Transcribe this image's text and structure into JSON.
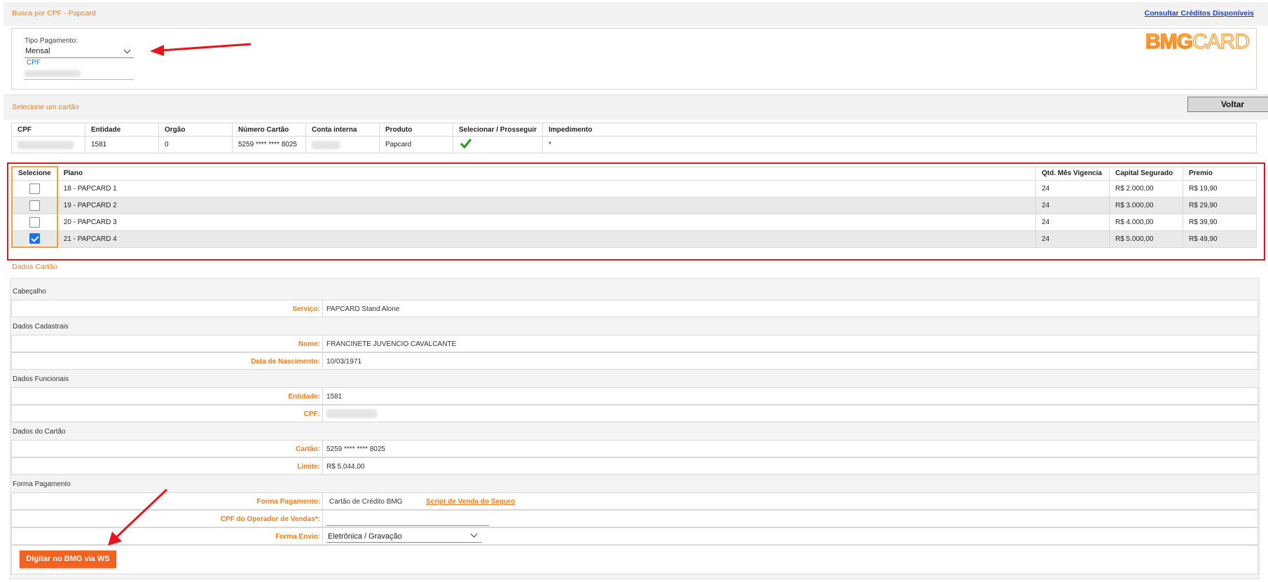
{
  "header": {
    "title": "Busca por CPF - Papcard",
    "link": "Consultar Créditos Disponíveis"
  },
  "filter": {
    "tipo_label": "Tipo Pagamento:",
    "tipo_value": "Mensal",
    "cpf_label": "CPF"
  },
  "logo": {
    "text_bmg": "BMG",
    "text_card": "CARD"
  },
  "section_select": {
    "title": "Selecione um cartão",
    "back_button": "Voltar"
  },
  "cards_table": {
    "headers": [
      "CPF",
      "Entidade",
      "Orgão",
      "Número Cartão",
      "Conta interna",
      "Produto",
      "Selecionar / Prosseguir",
      "Impedimento"
    ],
    "row": {
      "entidade": "1581",
      "orgao": "0",
      "numero": "5259 **** **** 8025",
      "produto": "Papcard",
      "impedimento": "*"
    }
  },
  "plans_table": {
    "headers": [
      "Selecione",
      "Plano",
      "Qtd. Mês Vigencia",
      "Capital Segurado",
      "Premio"
    ],
    "rows": [
      {
        "plano": "18 - PAPCARD 1",
        "qtd": "24",
        "capital": "R$ 2.000,00",
        "premio": "R$ 19,90",
        "checked": false
      },
      {
        "plano": "19 - PAPCARD 2",
        "qtd": "24",
        "capital": "R$ 3.000,00",
        "premio": "R$ 29,90",
        "checked": false
      },
      {
        "plano": "20 - PAPCARD 3",
        "qtd": "24",
        "capital": "R$ 4.000,00",
        "premio": "R$ 39,90",
        "checked": false
      },
      {
        "plano": "21 - PAPCARD 4",
        "qtd": "24",
        "capital": "R$ 5.000,00",
        "premio": "R$ 49,90",
        "checked": true
      }
    ]
  },
  "dados": {
    "title": "Dados Cartão",
    "cabecalho": "Cabeçalho",
    "servico_label": "Serviço:",
    "servico_value": "PAPCARD Stand Alone",
    "cadastrais": "Dados Cadastrais",
    "nome_label": "Nome:",
    "nome_value": "FRANCINETE JUVENCIO CAVALCANTE",
    "nasc_label": "Data de Nascimento:",
    "nasc_value": "10/03/1971",
    "funcionais": "Dados Funcionais",
    "entidade_label": "Entidade:",
    "entidade_value": "1581",
    "cpf_label": "CPF:",
    "cartao_section": "Dados do Cartão",
    "cartao_label": "Cartão:",
    "cartao_value": "5259 **** **** 8025",
    "limite_label": "Limite:",
    "limite_value": "R$ 5.044,00",
    "forma_section": "Forma Pagamento",
    "forma_label": "Forma Pagamento:",
    "forma_value": "Cartão de Crédito BMG",
    "script_link": "Script de Venda do Seguro",
    "operador_label": "CPF do Operador de Vendas*:",
    "envio_label": "Forma Envio:",
    "envio_value": "Eletrônica / Gravação",
    "submit": "Digitar no BMG via WS"
  },
  "colors": {
    "accent": "#f07c1b",
    "button": "#f26322",
    "highlight": "#e8141c",
    "check": "#1a73e8"
  }
}
